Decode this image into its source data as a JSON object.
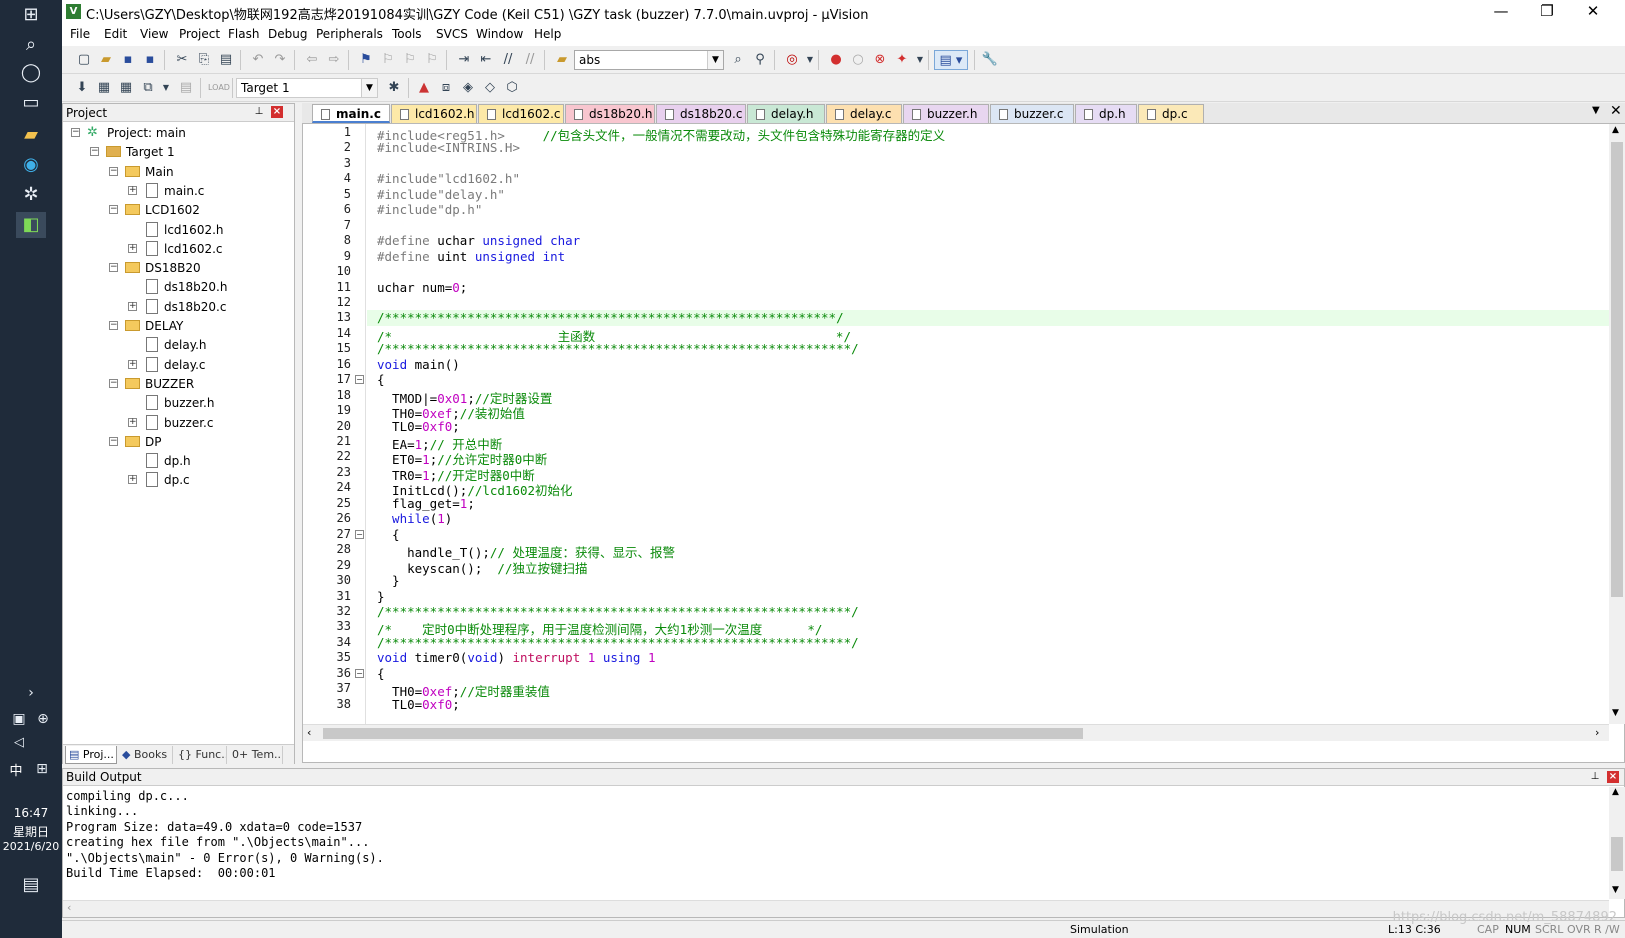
{
  "taskbar": {
    "clock": "16:47",
    "weekday": "星期日",
    "date": "2021/6/20",
    "ime": "中"
  },
  "window": {
    "title": "C:\\Users\\GZY\\Desktop\\物联网192高志烨20191084实训\\GZY Code   (Keil C51)  \\GZY task (buzzer) 7.7.0\\main.uvproj - µVision"
  },
  "menu": [
    "File",
    "Edit",
    "View",
    "Project",
    "Flash",
    "Debug",
    "Peripherals",
    "Tools",
    "SVCS",
    "Window",
    "Help"
  ],
  "toolbar": {
    "find_value": "abs",
    "target_value": "Target 1"
  },
  "project": {
    "title": "Project",
    "tree": [
      {
        "label": "Project: main",
        "level": 0,
        "type": "project"
      },
      {
        "label": "Target 1",
        "level": 1,
        "type": "target"
      },
      {
        "label": "Main",
        "level": 2,
        "type": "folder"
      },
      {
        "label": "main.c",
        "level": 3,
        "type": "file",
        "expand": true
      },
      {
        "label": "LCD1602",
        "level": 2,
        "type": "folder"
      },
      {
        "label": "lcd1602.h",
        "level": 3,
        "type": "file",
        "expand": false
      },
      {
        "label": "lcd1602.c",
        "level": 3,
        "type": "file",
        "expand": true
      },
      {
        "label": "DS18B20",
        "level": 2,
        "type": "folder"
      },
      {
        "label": "ds18b20.h",
        "level": 3,
        "type": "file",
        "expand": false
      },
      {
        "label": "ds18b20.c",
        "level": 3,
        "type": "file",
        "expand": true
      },
      {
        "label": "DELAY",
        "level": 2,
        "type": "folder"
      },
      {
        "label": "delay.h",
        "level": 3,
        "type": "file",
        "expand": false
      },
      {
        "label": "delay.c",
        "level": 3,
        "type": "file",
        "expand": true
      },
      {
        "label": "BUZZER",
        "level": 2,
        "type": "folder"
      },
      {
        "label": "buzzer.h",
        "level": 3,
        "type": "file",
        "expand": false
      },
      {
        "label": "buzzer.c",
        "level": 3,
        "type": "file",
        "expand": true
      },
      {
        "label": "DP",
        "level": 2,
        "type": "folder"
      },
      {
        "label": "dp.h",
        "level": 3,
        "type": "file",
        "expand": false
      },
      {
        "label": "dp.c",
        "level": 3,
        "type": "file",
        "expand": true
      }
    ],
    "tabs": [
      "Proj...",
      "Books",
      "{} Func...",
      "0+ Tem..."
    ]
  },
  "editor_tabs": [
    {
      "label": "main.c",
      "color": "#ffffff",
      "active": true
    },
    {
      "label": "lcd1602.h",
      "color": "#fde9a8"
    },
    {
      "label": "lcd1602.c",
      "color": "#fde9a8"
    },
    {
      "label": "ds18b20.h",
      "color": "#f8c6cf"
    },
    {
      "label": "ds18b20.c",
      "color": "#e8d0ee"
    },
    {
      "label": "delay.h",
      "color": "#c9e8d5"
    },
    {
      "label": "delay.c",
      "color": "#fde0b0"
    },
    {
      "label": "buzzer.h",
      "color": "#e8d6f0"
    },
    {
      "label": "buzzer.c",
      "color": "#dce6f4"
    },
    {
      "label": "dp.h",
      "color": "#e6dcf4"
    },
    {
      "label": "dp.c",
      "color": "#fbe9b8"
    }
  ],
  "code_lines": [
    [
      [
        "pp",
        "#include<reg51.h>"
      ],
      [
        "cm",
        "     //包含头文件，一般情况不需要改动，头文件包含特殊功能寄存器的定义"
      ]
    ],
    [
      [
        "pp",
        "#include<INTRINS.H>"
      ]
    ],
    [],
    [
      [
        "pp",
        "#include\"lcd1602.h\""
      ]
    ],
    [
      [
        "pp",
        "#include\"delay.h\""
      ]
    ],
    [
      [
        "pp",
        "#include\"dp.h\""
      ]
    ],
    [],
    [
      [
        "pp",
        "#define "
      ],
      [
        "id",
        "uchar "
      ],
      [
        "kw",
        "unsigned char"
      ]
    ],
    [
      [
        "pp",
        "#define "
      ],
      [
        "id",
        "uint "
      ],
      [
        "kw",
        "unsigned int"
      ]
    ],
    [],
    [
      [
        "id",
        "uchar num="
      ],
      [
        "num",
        "0"
      ],
      [
        "id",
        ";"
      ]
    ],
    [],
    [
      [
        "cm",
        "/************************************************************/"
      ]
    ],
    [
      [
        "cm",
        "/*                      主函数                                */"
      ]
    ],
    [
      [
        "cm",
        "/**************************************************************/"
      ]
    ],
    [
      [
        "kw",
        "void "
      ],
      [
        "id",
        "main()"
      ]
    ],
    [
      [
        "id",
        "{"
      ]
    ],
    [
      [
        "id",
        "  TMOD|="
      ],
      [
        "num",
        "0x01"
      ],
      [
        "id",
        ";"
      ],
      [
        "cm",
        "//定时器设置"
      ]
    ],
    [
      [
        "id",
        "  TH0="
      ],
      [
        "num",
        "0xef"
      ],
      [
        "id",
        ";"
      ],
      [
        "cm",
        "//装初始值"
      ]
    ],
    [
      [
        "id",
        "  TL0="
      ],
      [
        "num",
        "0xf0"
      ],
      [
        "id",
        ";"
      ]
    ],
    [
      [
        "id",
        "  EA="
      ],
      [
        "num",
        "1"
      ],
      [
        "id",
        ";"
      ],
      [
        "cm",
        "// 开总中断"
      ]
    ],
    [
      [
        "id",
        "  ET0="
      ],
      [
        "num",
        "1"
      ],
      [
        "id",
        ";"
      ],
      [
        "cm",
        "//允许定时器0中断"
      ]
    ],
    [
      [
        "id",
        "  TR0="
      ],
      [
        "num",
        "1"
      ],
      [
        "id",
        ";"
      ],
      [
        "cm",
        "//开定时器0中断"
      ]
    ],
    [
      [
        "id",
        "  InitLcd();"
      ],
      [
        "cm",
        "//lcd1602初始化"
      ]
    ],
    [
      [
        "id",
        "  flag_get="
      ],
      [
        "num",
        "1"
      ],
      [
        "id",
        ";"
      ]
    ],
    [
      [
        "kw",
        "  while"
      ],
      [
        "id",
        "("
      ],
      [
        "num",
        "1"
      ],
      [
        "id",
        ")"
      ]
    ],
    [
      [
        "id",
        "  {"
      ]
    ],
    [
      [
        "id",
        "    handle_T();"
      ],
      [
        "cm",
        "// 处理温度：获得、显示、报警"
      ]
    ],
    [
      [
        "id",
        "    keyscan();  "
      ],
      [
        "cm",
        "//独立按键扫描"
      ]
    ],
    [
      [
        "id",
        "  }"
      ]
    ],
    [
      [
        "id",
        "}"
      ]
    ],
    [
      [
        "cm",
        "/**************************************************************/"
      ]
    ],
    [
      [
        "cm",
        "/*    定时0中断处理程序，用于温度检测间隔，大约1秒测一次温度      */"
      ]
    ],
    [
      [
        "cm",
        "/**************************************************************/"
      ]
    ],
    [
      [
        "kw",
        "void "
      ],
      [
        "id",
        "timer0("
      ],
      [
        "kw",
        "void"
      ],
      [
        "id",
        ") "
      ],
      [
        "kw2",
        "interrupt "
      ],
      [
        "num",
        "1 "
      ],
      [
        "kw",
        "using "
      ],
      [
        "num",
        "1"
      ]
    ],
    [
      [
        "id",
        "{"
      ]
    ],
    [
      [
        "id",
        "  TH0="
      ],
      [
        "num",
        "0xef"
      ],
      [
        "id",
        ";"
      ],
      [
        "cm",
        "//定时器重装值"
      ]
    ],
    [
      [
        "id",
        "  TL0="
      ],
      [
        "num",
        "0xf0"
      ],
      [
        "id",
        ";"
      ]
    ]
  ],
  "build": {
    "title": "Build Output",
    "lines": [
      "compiling dp.c...",
      "linking...",
      "Program Size: data=49.0 xdata=0 code=1537",
      "creating hex file from \".\\Objects\\main\"...",
      "\".\\Objects\\main\" - 0 Error(s), 0 Warning(s).",
      "Build Time Elapsed:  00:00:01"
    ]
  },
  "status": {
    "mode": "Simulation",
    "cursor": "L:13 C:36",
    "caps": "CAP",
    "num": "NUM",
    "scrl": "SCRL",
    "ovr": "OVR",
    "rw": "R /W"
  },
  "watermark": "https://blog.csdn.net/m_58874892"
}
